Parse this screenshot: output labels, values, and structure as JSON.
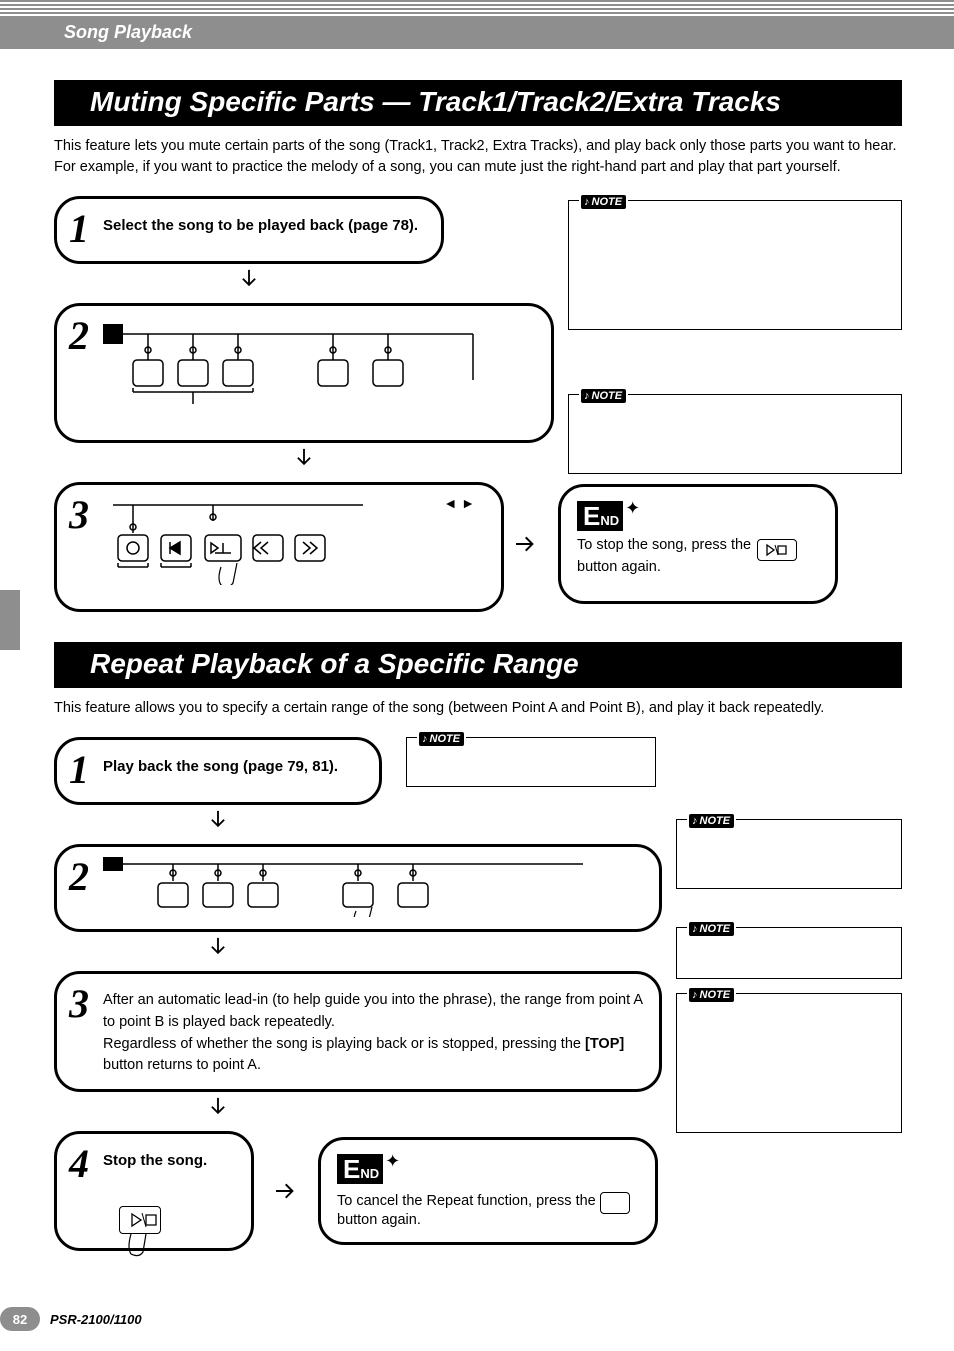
{
  "header": {
    "section": "Song Playback"
  },
  "page": {
    "number": "82",
    "model": "PSR-2100/1100"
  },
  "muting": {
    "title": "Muting Specific Parts — Track1/Track2/Extra Tracks",
    "intro": "This feature lets you mute certain parts of the song (Track1, Track2, Extra Tracks), and play back only those parts you want to hear. For example, if you want to practice the melody of a song, you can mute just the right-hand part and play that part yourself.",
    "step1": "Select the song to be played back (page 78).",
    "end_text": "To stop the song, press the ",
    "end_text2": " button again.",
    "note_label": "NOTE"
  },
  "repeat": {
    "title": "Repeat Playback of a Specific Range",
    "intro": "This feature allows you to specify a certain range of the song (between Point A and Point B), and play it back repeatedly.",
    "step1": "Play back the song (page 79, 81).",
    "step3a": "After an automatic lead-in (to help guide you into the phrase), the range from point A to point B is played back repeatedly.",
    "step3b_pre": "Regardless of whether the song is playing back or is stopped, pressing the ",
    "step3b_bold": "[TOP]",
    "step3b_post": " button returns to point A.",
    "step4": "Stop the song.",
    "end_text": "To cancel the Repeat function, press the ",
    "end_text2": " button again.",
    "note_label": "NOTE"
  }
}
